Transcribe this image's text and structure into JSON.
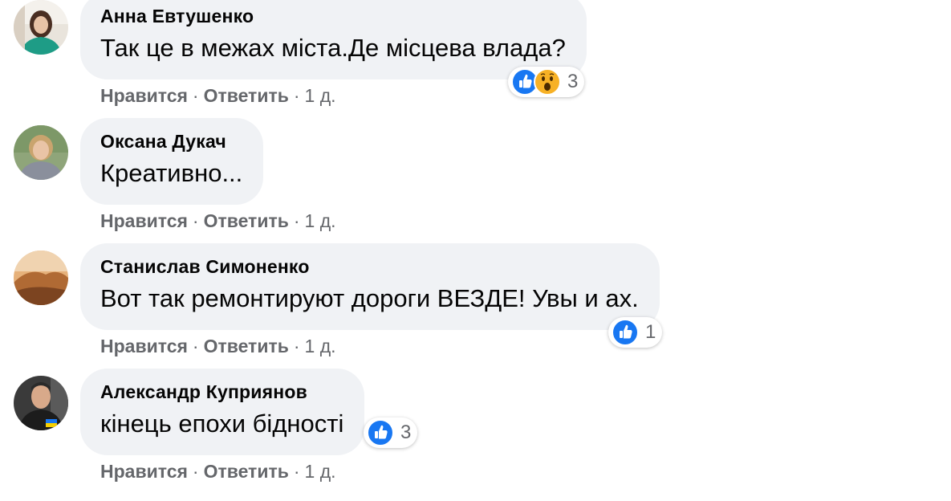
{
  "comments": [
    {
      "author": "Анна Евтушенко",
      "text": "Так це в межах міста.Де місцева влада?",
      "reactions": [
        "like-icon",
        "wow-icon"
      ],
      "reaction_count": "3",
      "like_label": "Нравится",
      "reply_label": "Ответить",
      "time": "1 д."
    },
    {
      "author": "Оксана Дукач",
      "text": "Креативно...",
      "reactions": [],
      "reaction_count": "",
      "like_label": "Нравится",
      "reply_label": "Ответить",
      "time": "1 д."
    },
    {
      "author": "Станислав Симоненко",
      "text": "Вот так ремонтируют дороги ВЕЗДЕ! Увы и ах.",
      "reactions": [
        "like-icon"
      ],
      "reaction_count": "1",
      "like_label": "Нравится",
      "reply_label": "Ответить",
      "time": "1 д."
    },
    {
      "author": "Александр Куприянов",
      "text": "кінець епохи бідності",
      "reactions": [
        "like-icon"
      ],
      "reaction_count": "3",
      "like_label": "Нравится",
      "reply_label": "Ответить",
      "time": "1 д."
    }
  ],
  "colors": {
    "bubble_bg": "#f0f2f5",
    "like_blue": "#1877f2",
    "wow_yellow": "#f7b125",
    "muted_text": "#65676b",
    "primary_text": "#050505"
  },
  "separator": "·"
}
